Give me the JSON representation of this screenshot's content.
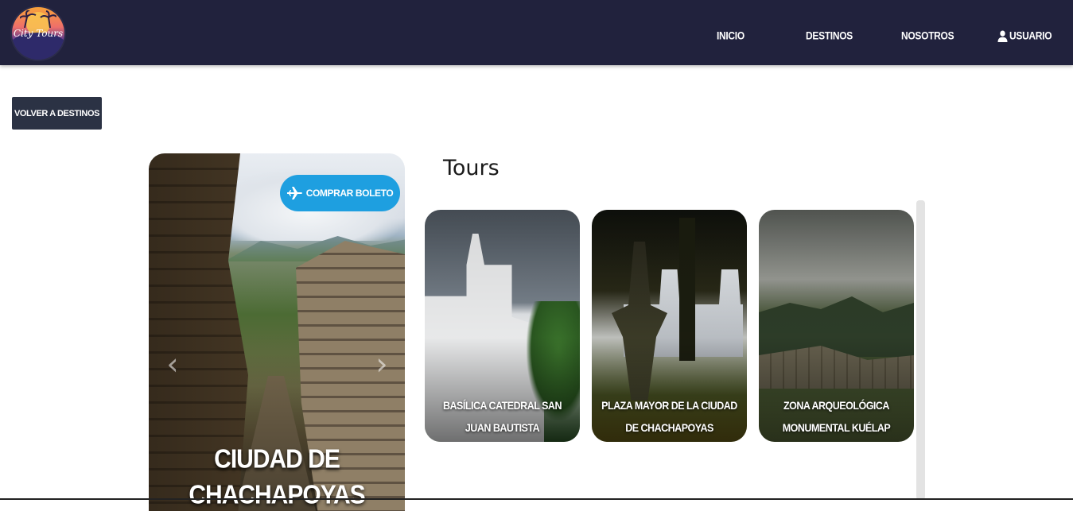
{
  "brand": {
    "logo_text": "City Tours",
    "primary_color": "#21223d",
    "accent_color": "#1e9fe0"
  },
  "nav": {
    "items": [
      {
        "label": "INICIO"
      },
      {
        "label": "DESTINOS"
      },
      {
        "label": "NOSOTROS"
      },
      {
        "label": "USUARIO",
        "icon": "user-icon"
      }
    ]
  },
  "back_button": {
    "label": "VOLVER A DESTINOS"
  },
  "destination": {
    "title": "CIUDAD DE CHACHAPOYAS",
    "buy_button": {
      "label": "COMPRAR BOLETO",
      "icon": "plane-icon"
    },
    "carousel": {
      "prev_icon": "chevron-left-icon",
      "next_icon": "chevron-right-icon"
    }
  },
  "tours": {
    "heading": "Tours",
    "items": [
      {
        "name": "BASÍLICA CATEDRAL SAN JUAN BAUTISTA"
      },
      {
        "name": "PLAZA MAYOR DE LA CIUDAD DE CHACHAPOYAS"
      },
      {
        "name": "ZONA ARQUEOLÓGICA MONUMENTAL KUÉLAP"
      }
    ]
  }
}
